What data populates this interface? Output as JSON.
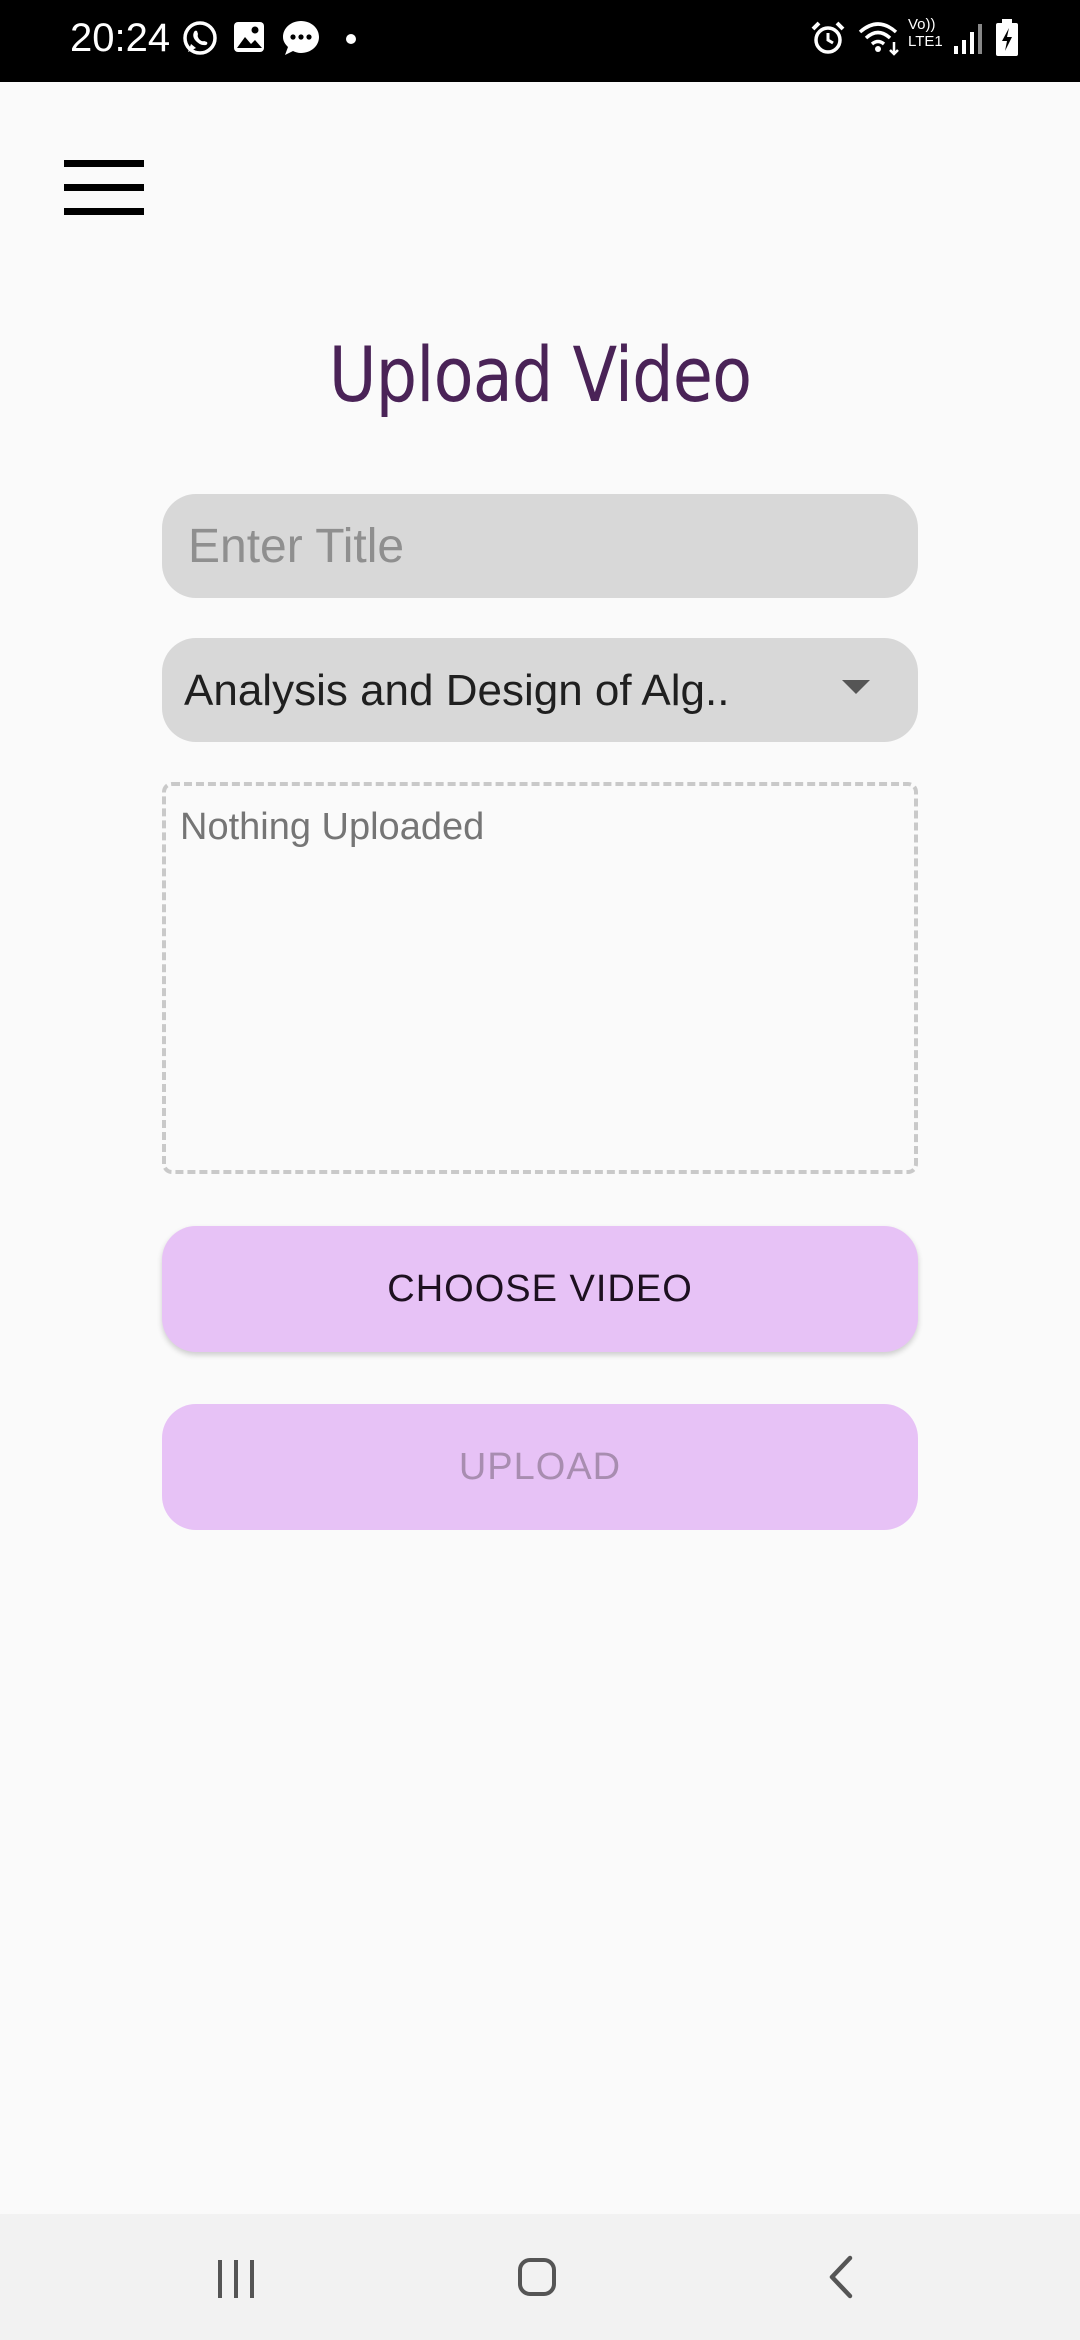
{
  "status_bar": {
    "time": "20:24",
    "left_icons": [
      "whatsapp-icon",
      "gallery-icon",
      "messages-icon",
      "dot-icon"
    ],
    "right_icons": [
      "alarm-icon",
      "wifi-icon",
      "volte-icon",
      "signal-icon",
      "battery-charging-icon"
    ],
    "volte_line1": "Vo))",
    "volte_line2": "LTE1"
  },
  "header": {
    "menu_icon": "hamburger-menu-icon"
  },
  "main": {
    "title": "Upload Video",
    "title_input": {
      "placeholder": "Enter Title",
      "value": ""
    },
    "subject_dropdown": {
      "selected": "Analysis and Design of Alg..",
      "icon": "caret-down-icon"
    },
    "preview": {
      "text": "Nothing Uploaded"
    },
    "choose_button": "CHOOSE VIDEO",
    "upload_button": "UPLOAD"
  },
  "nav_bar": {
    "icons": [
      "recents-icon",
      "home-icon",
      "back-icon"
    ]
  },
  "colors": {
    "title": "#4a2357",
    "button_bg": "#e7c2f6",
    "input_bg": "#d8d8d8",
    "background": "#fafafa"
  }
}
